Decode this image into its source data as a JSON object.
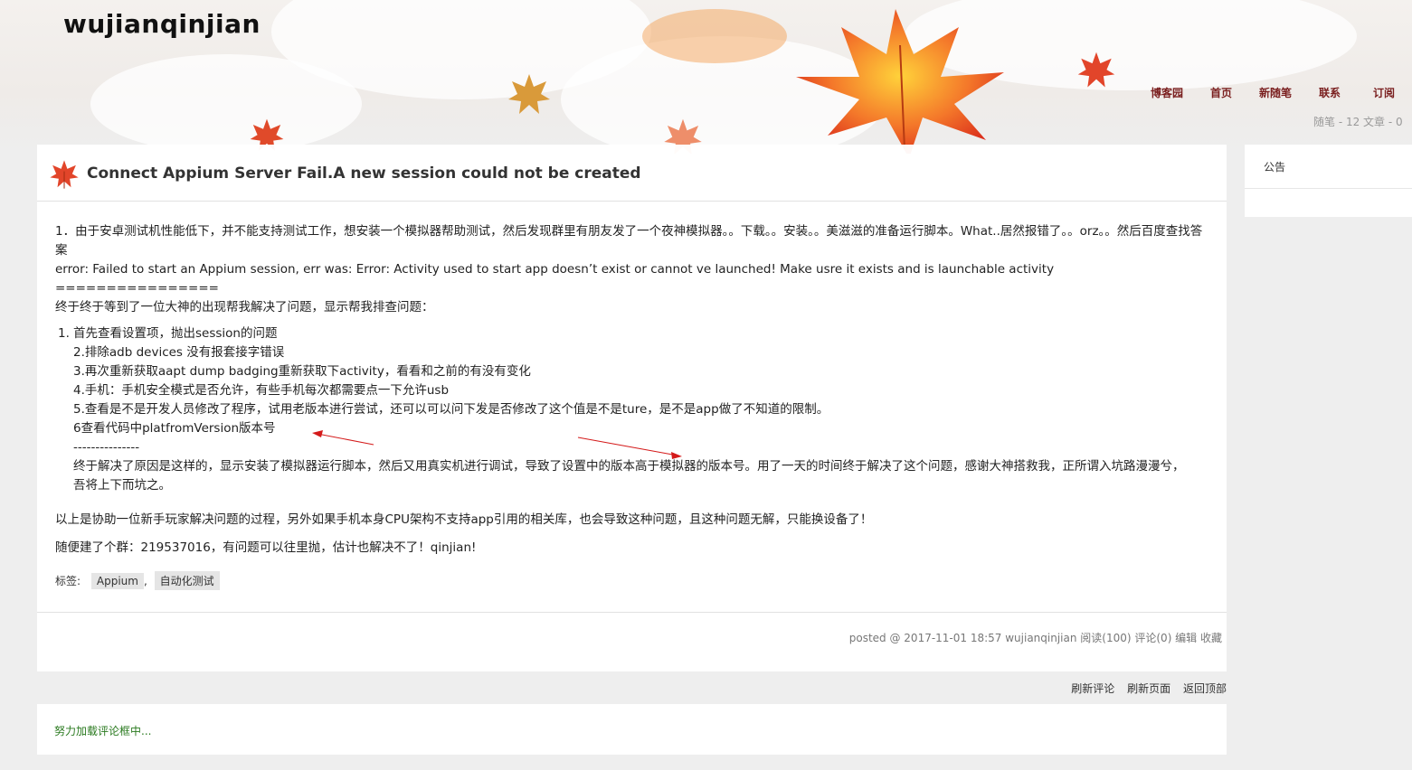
{
  "header": {
    "blog_title": "wujianqinjian",
    "nav": [
      "博客园",
      "首页",
      "新随笔",
      "联系",
      "订阅"
    ],
    "stats": "随笔 - 12  文章 - 0"
  },
  "post": {
    "title": "Connect Appium Server Fail.A new session could not be created",
    "paragraphs": [
      "1．由于安卓测试机性能低下，并不能支持测试工作，想安装一个模拟器帮助测试，然后发现群里有朋友发了一个夜神模拟器。。下载。。安装。。美滋滋的准备运行脚本。What..居然报错了。。orz。。然后百度查找答案",
      "error: Failed to start an Appium session, err was: Error: Activity used to start app doesn’t exist or cannot ve launched! Make usre it exists and is launchable activity",
      "================",
      "终于终于等到了一位大神的出现帮我解决了问题，显示帮我排查问题："
    ],
    "list_num": "1.",
    "list_lines": [
      "首先查看设置项，抛出session的问题",
      "2.排除adb devices 没有报套接字错误",
      "3.再次重新获取aapt dump badging重新获取下activity，看看和之前的有没有变化",
      "4.手机：手机安全模式是否允许，有些手机每次都需要点一下允许usb",
      "5.查看是不是开发人员修改了程序，试用老版本进行尝试，还可以可以问下发是否修改了这个值是不是ture，是不是app做了不知道的限制。",
      "6查看代码中platfromVersion版本号",
      "---------------",
      "终于解决了原因是这样的，显示安装了模拟器运行脚本，然后又用真实机进行调试，导致了设置中的版本高于模拟器的版本号。用了一天的时间终于解决了这个问题，感谢大神搭救我，正所谓入坑路漫漫兮，吾将上下而坑之。"
    ],
    "after_list_1": "以上是协助一位新手玩家解决问题的过程，另外如果手机本身CPU架构不支持app引用的相关库，也会导致这种问题，且这种问题无解，只能换设备了！",
    "after_list_2": "随便建了个群：219537016，有问题可以往里抛，估计也解决不了！qinjian!",
    "tags_label": "标签:",
    "tags": [
      "Appium",
      "自动化测试"
    ],
    "tag_sep": ",",
    "meta": "posted @ 2017-11-01 18:57 wujianqinjian 阅读(100) 评论(0) 编辑 收藏"
  },
  "comments": {
    "links": [
      "刷新评论",
      "刷新页面",
      "返回顶部"
    ],
    "loading": "努力加载评论框中..."
  },
  "sidebar": {
    "title": "公告"
  },
  "colors": {
    "nav_link": "#7a1f1f",
    "loading_text": "#2a7a1f",
    "arrow": "#d41a1a"
  }
}
